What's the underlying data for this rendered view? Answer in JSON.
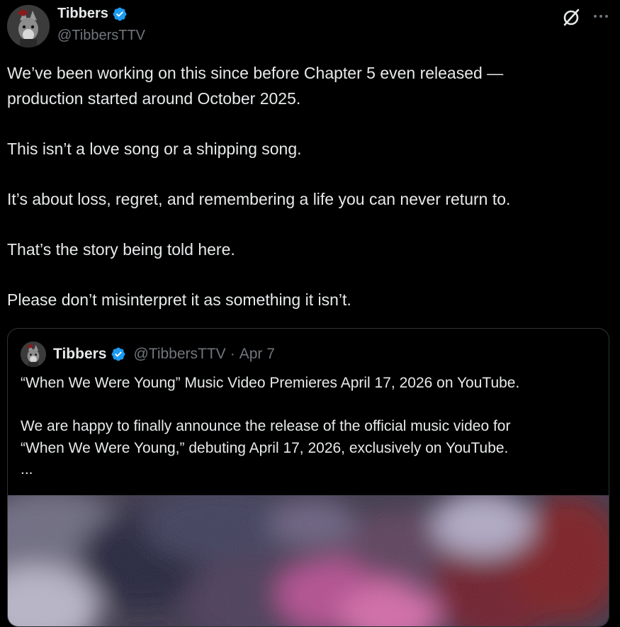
{
  "author": {
    "name": "Tibbers",
    "handle": "@TibbersTTV",
    "verified": true,
    "avatar_icon": "wolf-avatar-icon"
  },
  "post": {
    "text": "We’ve been working on this since before Chapter 5 even released —\nproduction started around October 2025.\n\nThis isn’t a love song or a shipping song.\n\nIt’s about loss, regret, and remembering a life you can never return to.\n\nThat’s the story being told here.\n\nPlease don’t misinterpret it as something it isn’t."
  },
  "actions": {
    "grok_icon": "grok-icon",
    "more_icon": "more-options-icon"
  },
  "quoted_post": {
    "name": "Tibbers",
    "handle": "@TibbersTTV",
    "separator": "·",
    "date": "Apr 7",
    "text": "“When We Were Young” Music Video Premieres April 17, 2026 on YouTube.\n\nWe are happy to finally announce the release of the official music video for\n“When We Were Young,” debuting April 17, 2026, exclusively on YouTube.\n...",
    "media": "blurred-artwork-image"
  },
  "colors": {
    "background": "#000000",
    "text": "#e7e9ea",
    "secondary": "#71767b",
    "verified": "#1d9bf0",
    "border": "#2f3336"
  }
}
